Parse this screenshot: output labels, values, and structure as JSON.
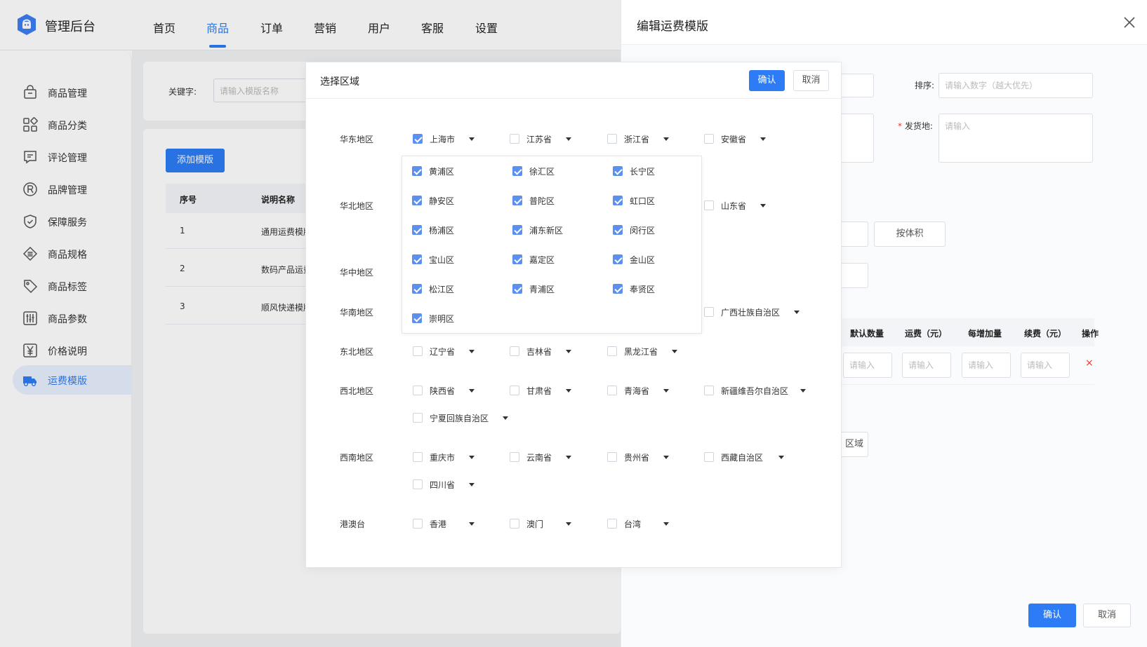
{
  "app": {
    "title": "管理后台"
  },
  "nav": [
    "首页",
    "商品",
    "订单",
    "营销",
    "用户",
    "客服",
    "设置"
  ],
  "nav_active": "商品",
  "sidebar": {
    "items": [
      {
        "label": "商品管理",
        "icon": "shopping-bag-icon"
      },
      {
        "label": "商品分类",
        "icon": "category-grid-icon"
      },
      {
        "label": "评论管理",
        "icon": "comment-icon"
      },
      {
        "label": "品牌管理",
        "icon": "registered-icon"
      },
      {
        "label": "保障服务",
        "icon": "shield-icon"
      },
      {
        "label": "商品规格",
        "icon": "spec-icon"
      },
      {
        "label": "商品标签",
        "icon": "tag-icon"
      },
      {
        "label": "商品参数",
        "icon": "sliders-icon"
      },
      {
        "label": "价格说明",
        "icon": "yen-icon"
      },
      {
        "label": "运费模版",
        "icon": "truck-icon"
      }
    ],
    "active": "运费模版"
  },
  "content": {
    "search": {
      "label": "关键字:",
      "placeholder": "请输入模版名称"
    },
    "add_button": "添加模版",
    "table": {
      "headers": [
        "序号",
        "说明名称"
      ],
      "rows": [
        [
          "1",
          "通用运费模版"
        ],
        [
          "2",
          "数码产品运费模"
        ],
        [
          "3",
          "顺风快递模版"
        ]
      ]
    }
  },
  "drawer": {
    "title": "编辑运费模版",
    "sort_label": "排序:",
    "sort_placeholder": "请输入数字（越大优先）",
    "origin_label": "发货地:",
    "origin_required": "*",
    "origin_placeholder": "请输入",
    "volume_button": "按体积",
    "fee_table": {
      "headers": [
        "默认数量",
        "运费（元）",
        "每增加量",
        "续费（元）",
        "操作"
      ],
      "placeholder": "请输入",
      "delete_glyph": "×"
    },
    "region_button_partial": "区域",
    "confirm": "确认",
    "cancel": "取消"
  },
  "modal": {
    "title": "选择区域",
    "confirm": "确认",
    "cancel": "取消",
    "regions": [
      {
        "name": "华东地区",
        "provinces": [
          {
            "name": "上海市",
            "checked": true
          },
          {
            "name": "江苏省",
            "checked": false
          },
          {
            "name": "浙江省",
            "checked": false
          },
          {
            "name": "安徽省",
            "checked": false
          }
        ]
      },
      {
        "name": "华北地区",
        "provinces": [
          {
            "name": "山东省",
            "checked": false
          }
        ]
      },
      {
        "name": "华中地区",
        "provinces": []
      },
      {
        "name": "华南地区",
        "provinces": [
          {
            "name": "广西壮族自治区",
            "checked": false
          }
        ]
      },
      {
        "name": "东北地区",
        "provinces": [
          {
            "name": "辽宁省",
            "checked": false
          },
          {
            "name": "吉林省",
            "checked": false
          },
          {
            "name": "黑龙江省",
            "checked": false
          }
        ]
      },
      {
        "name": "西北地区",
        "provinces": [
          {
            "name": "陕西省",
            "checked": false
          },
          {
            "name": "甘肃省",
            "checked": false
          },
          {
            "name": "青海省",
            "checked": false
          },
          {
            "name": "新疆维吾尔自治区",
            "checked": false
          },
          {
            "name": "宁夏回族自治区",
            "checked": false
          }
        ]
      },
      {
        "name": "西南地区",
        "provinces": [
          {
            "name": "重庆市",
            "checked": false
          },
          {
            "name": "云南省",
            "checked": false
          },
          {
            "name": "贵州省",
            "checked": false
          },
          {
            "name": "西藏自治区",
            "checked": false
          },
          {
            "name": "四川省",
            "checked": false
          }
        ]
      },
      {
        "name": "港澳台",
        "provinces": [
          {
            "name": "香港",
            "checked": false
          },
          {
            "name": "澳门",
            "checked": false
          },
          {
            "name": "台湾",
            "checked": false
          }
        ]
      }
    ],
    "districts": [
      {
        "name": "黄浦区",
        "checked": true
      },
      {
        "name": "徐汇区",
        "checked": true
      },
      {
        "name": "长宁区",
        "checked": true
      },
      {
        "name": "静安区",
        "checked": true
      },
      {
        "name": "普陀区",
        "checked": true
      },
      {
        "name": "虹口区",
        "checked": true
      },
      {
        "name": "杨浦区",
        "checked": true
      },
      {
        "name": "浦东新区",
        "checked": true
      },
      {
        "name": "闵行区",
        "checked": true
      },
      {
        "name": "宝山区",
        "checked": true
      },
      {
        "name": "嘉定区",
        "checked": true
      },
      {
        "name": "金山区",
        "checked": true
      },
      {
        "name": "松江区",
        "checked": true
      },
      {
        "name": "青浦区",
        "checked": true
      },
      {
        "name": "奉贤区",
        "checked": true
      },
      {
        "name": "崇明区",
        "checked": true
      }
    ]
  },
  "colors": {
    "primary": "#2d7cf6",
    "checkbox_checked": "#5b8ff0",
    "danger": "#e53935",
    "content_bg": "#f0f2f5"
  }
}
